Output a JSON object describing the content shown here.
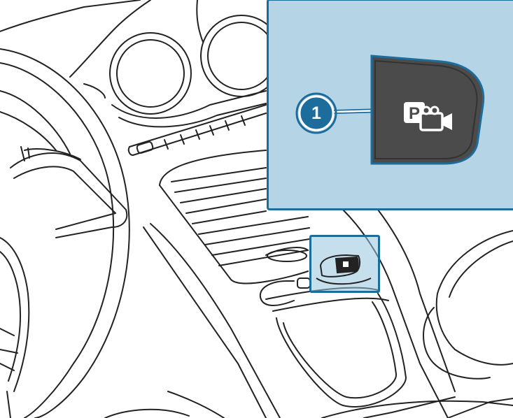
{
  "figure": {
    "callout": {
      "number": "1",
      "button_icon": "parking-camera-icon",
      "button_icon_letter": "P"
    },
    "colors": {
      "panel_fill": "#b5d4e6",
      "accent": "#1c6c9c",
      "button_fill": "#4b4b4b",
      "line_art": "#222222"
    }
  }
}
